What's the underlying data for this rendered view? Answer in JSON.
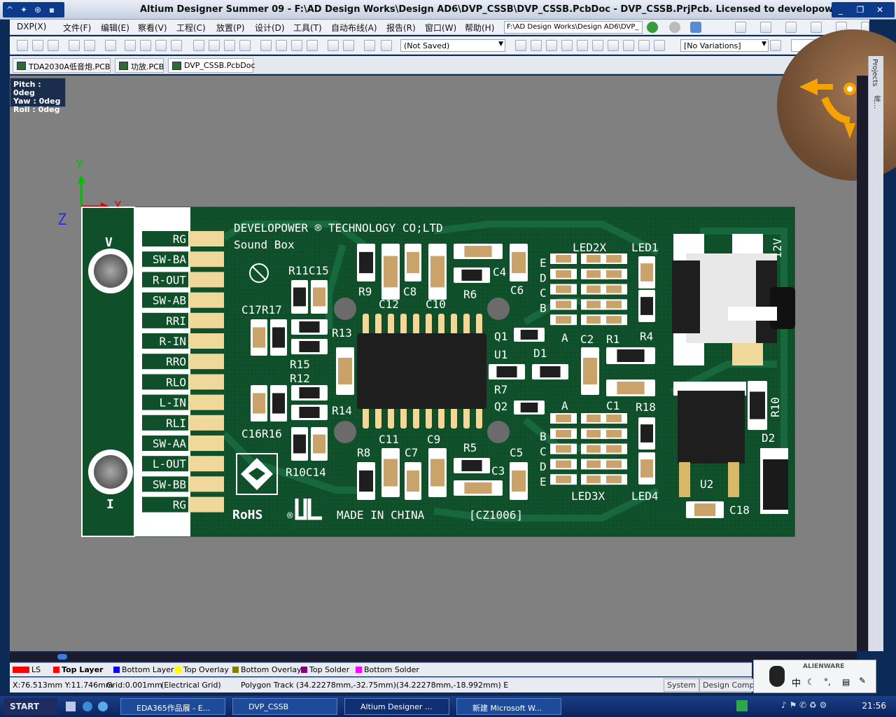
{
  "window": {
    "title": "Altium Designer Summer 09 - F:\\AD Design Works\\Design AD6\\DVP_CSSB\\DVP_CSSB.PcbDoc - DVP_CSSB.PrjPcb. Licensed to developower"
  },
  "menu": {
    "items": [
      "DXP(X)",
      "文件(F)",
      "编辑(E)",
      "察看(V)",
      "工程(C)",
      "放置(P)",
      "设计(D)",
      "工具(T)",
      "自动布线(A)",
      "报告(R)",
      "窗口(W)",
      "帮助(H)"
    ],
    "path": "F:\\AD Design Works\\Design AD6\\DVP_"
  },
  "toolbar": {
    "saved_combo": "(Not Saved)",
    "variations_combo": "[No Variations]"
  },
  "tabs": [
    "TDA2030A低音炮.PCB",
    "功放.PCB",
    "DVP_CSSB.PcbDoc"
  ],
  "orientation": {
    "pitch": "Pitch : 0deg",
    "yaw": "Yaw : 0deg",
    "roll": "Roll : 0deg"
  },
  "axes": {
    "y": "Y",
    "x": "X",
    "z": "Z"
  },
  "pcb": {
    "company": "DEVELOPOWER ® TECHNOLOGY CO;LTD",
    "product": "Sound Box",
    "made_in": "MADE IN CHINA",
    "code": "[CZ1006]",
    "rohs": "RoHS",
    "ul": "®",
    "connector_pins": [
      "RG",
      "SW-BA",
      "R-OUT",
      "SW-AB",
      "RRI",
      "R-IN",
      "RRO",
      "RLO",
      "L-IN",
      "RLI",
      "SW-AA",
      "L-OUT",
      "SW-BB",
      "RG"
    ],
    "hole_labels": [
      "V",
      "I"
    ],
    "designators": {
      "r11c15": "R11C15",
      "c17r17": "C17R17",
      "r13": "R13",
      "r15": "R15",
      "r12": "R12",
      "r14": "R14",
      "c16r16": "C16R16",
      "r10c14": "R10C14",
      "r9": "R9",
      "c12": "C12",
      "c8": "C8",
      "c10": "C10",
      "r6": "R6",
      "c4": "C4",
      "c6": "C6",
      "q1": "Q1",
      "u1": "U1",
      "d1": "D1",
      "r7": "R7",
      "q2": "Q2",
      "c11": "C11",
      "c7": "C7",
      "c9": "C9",
      "r8": "R8",
      "r5": "R5",
      "c3": "C3",
      "c5": "C5",
      "led2x": "LED2X",
      "led1": "LED1",
      "led3x": "LED3X",
      "led4": "LED4",
      "a1": "A",
      "a2": "A",
      "c2": "C2",
      "r1": "R1",
      "r4": "R4",
      "c1": "C1",
      "r18": "R18",
      "r10": "R10",
      "d2": "D2",
      "u2": "U2",
      "c18": "C18",
      "v12": "12V",
      "c3b": "B"
    },
    "led_letters_top": [
      "E",
      "D",
      "C",
      "B"
    ],
    "led_letters_bottom": [
      "B",
      "C",
      "D",
      "E"
    ]
  },
  "layers": [
    {
      "name": "LS",
      "color": "#ff0000"
    },
    {
      "name": "Top Layer",
      "color": "#ff0000"
    },
    {
      "name": "Bottom Layer",
      "color": "#0000ff"
    },
    {
      "name": "Top Overlay",
      "color": "#ffff00"
    },
    {
      "name": "Bottom Overlay",
      "color": "#808000"
    },
    {
      "name": "Top Solder",
      "color": "#800080"
    },
    {
      "name": "Bottom Solder",
      "color": "#ff00ff"
    }
  ],
  "status": {
    "coords": "X:76.513mm Y:11.746mm",
    "grid": "Grid:0.001mm",
    "grid_type": "(Electrical Grid)",
    "info": "Polygon Track (34.22278mm,-32.75mm)(34.22278mm,-18.992mm) E",
    "system": "System",
    "design_compiler": "Design Compile"
  },
  "right_panel": [
    "Projects",
    "库..."
  ],
  "tray": {
    "brand": "ALIENWARE",
    "ime": "中"
  },
  "taskbar": {
    "start": "START",
    "tasks": [
      "EDA365作品展 - E...",
      "DVP_CSSB",
      "Altium Designer ...",
      "新建 Microsoft W..."
    ],
    "clock": "21:56"
  }
}
